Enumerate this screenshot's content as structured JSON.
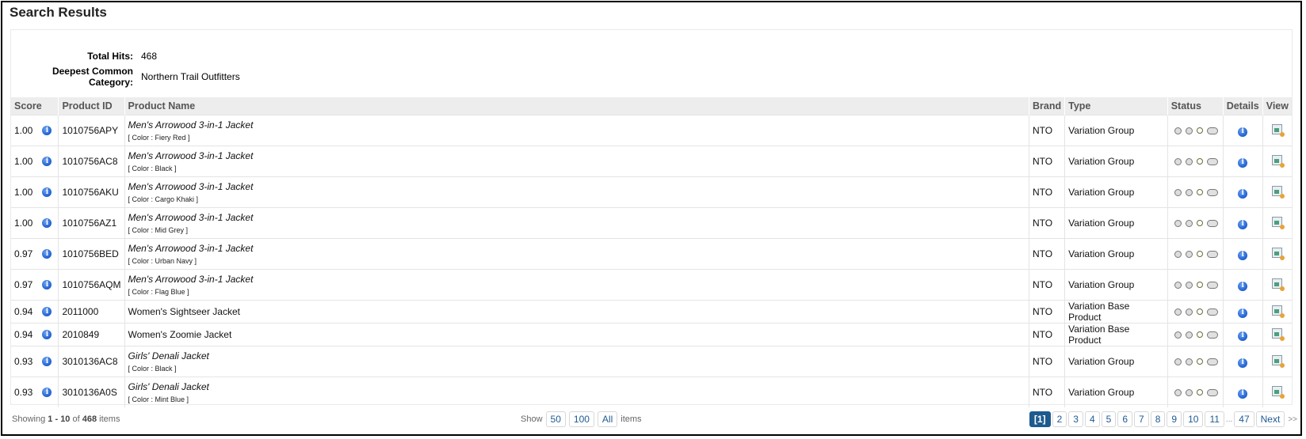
{
  "page": {
    "title": "Search Results"
  },
  "summary": {
    "total_hits_label": "Total Hits:",
    "total_hits_value": "468",
    "category_label": "Deepest Common Category:",
    "category_value": "Northern Trail Outfitters"
  },
  "table": {
    "headers": [
      "Score",
      "Product ID",
      "Product Name",
      "Brand",
      "Type",
      "Status",
      "Details",
      "View"
    ],
    "rows": [
      {
        "score": "1.00",
        "id": "1010756APY",
        "name": "Men's Arrowood 3-in-1 Jacket",
        "sub": "[ Color :  Fiery Red ]",
        "brand": "NTO",
        "type": "Variation Group"
      },
      {
        "score": "1.00",
        "id": "1010756AC8",
        "name": "Men's Arrowood 3-in-1 Jacket",
        "sub": "[ Color :  Black ]",
        "brand": "NTO",
        "type": "Variation Group"
      },
      {
        "score": "1.00",
        "id": "1010756AKU",
        "name": "Men's Arrowood 3-in-1 Jacket",
        "sub": "[ Color :  Cargo Khaki ]",
        "brand": "NTO",
        "type": "Variation Group"
      },
      {
        "score": "1.00",
        "id": "1010756AZ1",
        "name": "Men's Arrowood 3-in-1 Jacket",
        "sub": "[ Color :  Mid Grey ]",
        "brand": "NTO",
        "type": "Variation Group"
      },
      {
        "score": "0.97",
        "id": "1010756BED",
        "name": "Men's Arrowood 3-in-1 Jacket",
        "sub": "[ Color :  Urban Navy ]",
        "brand": "NTO",
        "type": "Variation Group"
      },
      {
        "score": "0.97",
        "id": "1010756AQM",
        "name": "Men's Arrowood 3-in-1 Jacket",
        "sub": "[ Color :  Flag Blue ]",
        "brand": "NTO",
        "type": "Variation Group"
      },
      {
        "score": "0.94",
        "id": "2011000",
        "name": "Women's Sightseer Jacket",
        "sub": "",
        "brand": "NTO",
        "type": "Variation Base Product"
      },
      {
        "score": "0.94",
        "id": "2010849",
        "name": "Women's Zoomie Jacket",
        "sub": "",
        "brand": "NTO",
        "type": "Variation Base Product"
      },
      {
        "score": "0.93",
        "id": "3010136AC8",
        "name": "Girls' Denali Jacket",
        "sub": "[ Color :  Black ]",
        "brand": "NTO",
        "type": "Variation Group"
      },
      {
        "score": "0.93",
        "id": "3010136A0S",
        "name": "Girls' Denali Jacket",
        "sub": "[ Color :  Mint Blue ]",
        "brand": "NTO",
        "type": "Variation Group"
      }
    ],
    "status_icons": [
      "online-status-icon",
      "searchable-icon",
      "search-icon",
      "key-icon"
    ],
    "details_icon": "info-icon",
    "view_icon": "view-product-icon"
  },
  "footer": {
    "showing_prefix": "Showing",
    "range_start": "1",
    "range_sep": "-",
    "range_end": "10",
    "of": "of",
    "total": "468",
    "items": "items",
    "show_label": "Show",
    "page_sizes": [
      "50",
      "100",
      "All"
    ],
    "show_items_label": "items",
    "pages": [
      "[1]",
      "2",
      "3",
      "4",
      "5",
      "6",
      "7",
      "8",
      "9",
      "10",
      "11"
    ],
    "ellipsis": "...",
    "last_page": "47",
    "next_label": "Next",
    "next_arrows": ">>"
  }
}
